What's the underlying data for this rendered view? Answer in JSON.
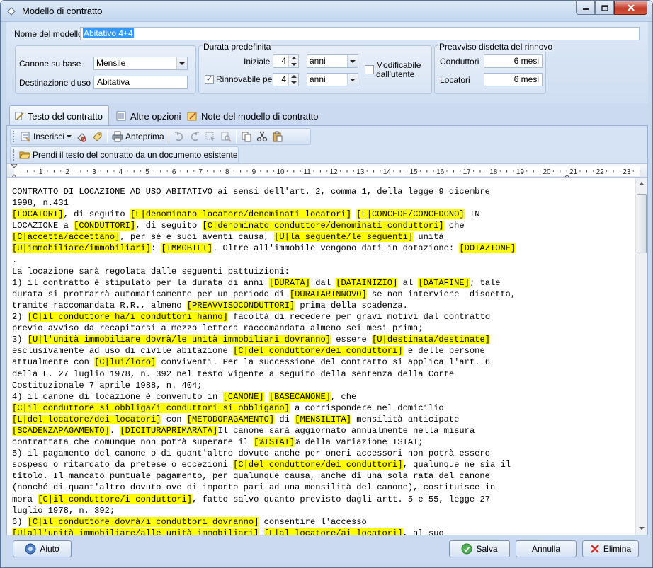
{
  "window": {
    "title": "Modello di contratto"
  },
  "header": {
    "nome_label": "Nome del modello",
    "nome_value": "Abitativo 4+4"
  },
  "canone": {
    "canone_label": "Canone su base",
    "canone_value": "Mensile",
    "destinazione_label": "Destinazione d'uso",
    "destinazione_value": "Abitativa"
  },
  "durata": {
    "legend": "Durata predefinita",
    "iniziale_label": "Iniziale",
    "iniziale_value": "4",
    "iniziale_unit": "anni",
    "rinnovabile_label": "Rinnovabile per",
    "rinnovabile_checked": true,
    "rinnovabile_value": "4",
    "rinnovabile_unit": "anni",
    "modificabile_label_1": "Modificabile",
    "modificabile_label_2": "dall'utente",
    "modificabile_checked": false
  },
  "preavviso": {
    "legend": "Preavviso disdetta del rinnovo",
    "conduttori_label": "Conduttori",
    "conduttori_value": "6 mesi",
    "locatori_label": "Locatori",
    "locatori_value": "6 mesi"
  },
  "tabs": [
    {
      "label": "Testo del contratto",
      "active": true
    },
    {
      "label": "Altre opzioni",
      "active": false
    },
    {
      "label": "Note del modello di contratto",
      "active": false
    }
  ],
  "toolbar": {
    "inserisci_label": "Inserisci",
    "anteprima_label": "Anteprima",
    "prendi_label": "Prendi il testo del contratto da un documento esistente"
  },
  "ruler": {
    "labels": [
      "1",
      "2",
      "3",
      "4",
      "5",
      "6",
      "7",
      "8",
      "9",
      "10",
      "11",
      "12",
      "13",
      "14",
      "15",
      "16",
      "17",
      "18",
      "19",
      "20",
      "21",
      "22",
      "23"
    ]
  },
  "document": {
    "lines": [
      [
        [
          "CONTRATTO DI LOCAZIONE AD USO ABITATIVO ai sensi dell'art. 2, comma 1, della legge 9 dicembre",
          0
        ]
      ],
      [
        [
          "1998, n.431",
          0
        ]
      ],
      [
        [
          "[LOCATORI]",
          1
        ],
        [
          ", di seguito ",
          0
        ],
        [
          "[L|denominato locatore/denominati locatori]",
          1
        ],
        [
          " ",
          0
        ],
        [
          "[L|CONCEDE/CONCEDONO]",
          1
        ],
        [
          " IN",
          0
        ]
      ],
      [
        [
          "LOCAZIONE a ",
          0
        ],
        [
          "[CONDUTTORI]",
          1
        ],
        [
          ", di seguito ",
          0
        ],
        [
          "[C|denominato conduttore/denominati conduttori]",
          1
        ],
        [
          " che",
          0
        ]
      ],
      [
        [
          "[C|accetta/accettano]",
          1
        ],
        [
          ", per sé e suoi aventi causa, ",
          0
        ],
        [
          "[U|la seguente/le seguenti]",
          1
        ],
        [
          " unità",
          0
        ]
      ],
      [
        [
          "[U|immobiliare/immobiliari]",
          1
        ],
        [
          ": ",
          0
        ],
        [
          "[IMMOBILI]",
          1
        ],
        [
          ". Oltre all'immobile vengono dati in dotazione: ",
          0
        ],
        [
          "[DOTAZIONE]",
          1
        ]
      ],
      [
        [
          ".",
          0
        ]
      ],
      [
        [
          "La locazione sarà regolata dalle seguenti pattuizioni:",
          0
        ]
      ],
      [
        [
          "1) il contratto è stipulato per la durata di anni ",
          0
        ],
        [
          "[DURATA]",
          1
        ],
        [
          " dal ",
          0
        ],
        [
          "[DATAINIZIO]",
          1
        ],
        [
          " al ",
          0
        ],
        [
          "[DATAFINE]",
          1
        ],
        [
          "; tale",
          0
        ]
      ],
      [
        [
          "durata si protrarrà automaticamente per un periodo di ",
          0
        ],
        [
          "[DURATARINNOVO]",
          1
        ],
        [
          " se non interviene  disdetta,",
          0
        ]
      ],
      [
        [
          "tramite raccomandata R.R., almeno ",
          0
        ],
        [
          "[PREAVVISOCONDUTTORI]",
          1
        ],
        [
          " prima della scadenza.",
          0
        ]
      ],
      [
        [
          "2) ",
          0
        ],
        [
          "[C|il conduttore ha/i conduttori hanno]",
          1
        ],
        [
          " facoltà di recedere per gravi motivi dal contratto",
          0
        ]
      ],
      [
        [
          "previo avviso da recapitarsi a mezzo lettera raccomandata almeno sei mesi prima;",
          0
        ]
      ],
      [
        [
          "3) ",
          0
        ],
        [
          "[U|l'unità immobiliare dovrà/le unità immobiliari dovranno]",
          1
        ],
        [
          " essere ",
          0
        ],
        [
          "[U|destinata/destinate]",
          1
        ]
      ],
      [
        [
          "esclusivamente ad uso di civile abitazione ",
          0
        ],
        [
          "[C|del conduttore/dei conduttori]",
          1
        ],
        [
          " e delle persone",
          0
        ]
      ],
      [
        [
          "attualmente con ",
          0
        ],
        [
          "[C|lui/loro]",
          1
        ],
        [
          " conviventi. Per la successione del contratto si applica l'art. 6",
          0
        ]
      ],
      [
        [
          "della L. 27 luglio 1978, n. 392 nel testo vigente a seguito della sentenza della Corte",
          0
        ]
      ],
      [
        [
          "Costituzionale 7 aprile 1988, n. 404;",
          0
        ]
      ],
      [
        [
          "4) il canone di locazione è convenuto in ",
          0
        ],
        [
          "[CANONE]",
          1
        ],
        [
          " ",
          0
        ],
        [
          "[BASECANONE]",
          1
        ],
        [
          ", che",
          0
        ]
      ],
      [
        [
          "[C|il conduttore si obbliga/i conduttori si obbligano]",
          1
        ],
        [
          " a corrispondere nel domicilio",
          0
        ]
      ],
      [
        [
          "[L|del locatore/dei locatori]",
          1
        ],
        [
          " con ",
          0
        ],
        [
          "[METODOPAGAMENTO]",
          1
        ],
        [
          " di ",
          0
        ],
        [
          "[MENSILITA]",
          1
        ],
        [
          " mensilità anticipate",
          0
        ]
      ],
      [
        [
          "[SCADENZAPAGAMENTO]",
          1
        ],
        [
          ". ",
          0
        ],
        [
          "[DICITURAPRIMARATA]",
          1
        ],
        [
          "Il canone sarà aggiornato annualmente nella misura",
          0
        ]
      ],
      [
        [
          "contrattata che comunque non potrà superare il ",
          0
        ],
        [
          "[%ISTAT]",
          1
        ],
        [
          "% della variazione ISTAT;",
          0
        ]
      ],
      [
        [
          "5) il pagamento del canone o di quant'altro dovuto anche per oneri accessori non potrà essere",
          0
        ]
      ],
      [
        [
          "sospeso o ritardato da pretese o eccezioni ",
          0
        ],
        [
          "[C|del conduttore/dei conduttori]",
          1
        ],
        [
          ", qualunque ne sia il",
          0
        ]
      ],
      [
        [
          "titolo. Il mancato puntuale pagamento, per qualunque causa, anche di una sola rata del canone",
          0
        ]
      ],
      [
        [
          "(nonché di quant'altro dovuto ove di importo pari ad una mensilità del canone), costituisce in",
          0
        ]
      ],
      [
        [
          "mora ",
          0
        ],
        [
          "[C|il conduttore/i conduttori]",
          1
        ],
        [
          ", fatto salvo quanto previsto dagli artt. 5 e 55, legge 27",
          0
        ]
      ],
      [
        [
          "luglio 1978, n. 392;",
          0
        ]
      ],
      [
        [
          "6) ",
          0
        ],
        [
          "[C|il conduttore dovrà/i conduttori dovranno]",
          1
        ],
        [
          " consentire l'accesso",
          0
        ]
      ],
      [
        [
          "[U|all'unità immobiliare/alle unità immobiliari]",
          1
        ],
        [
          " ",
          0
        ],
        [
          "[L|al locatore/ai locatori]",
          1
        ],
        [
          ", al suo",
          0
        ]
      ]
    ]
  },
  "buttons": {
    "aiuto": "Aiuto",
    "salva": "Salva",
    "annulla": "Annulla",
    "elimina": "Elimina"
  },
  "colors": {
    "highlight": "#ffff00",
    "accent": "#3399ff"
  }
}
